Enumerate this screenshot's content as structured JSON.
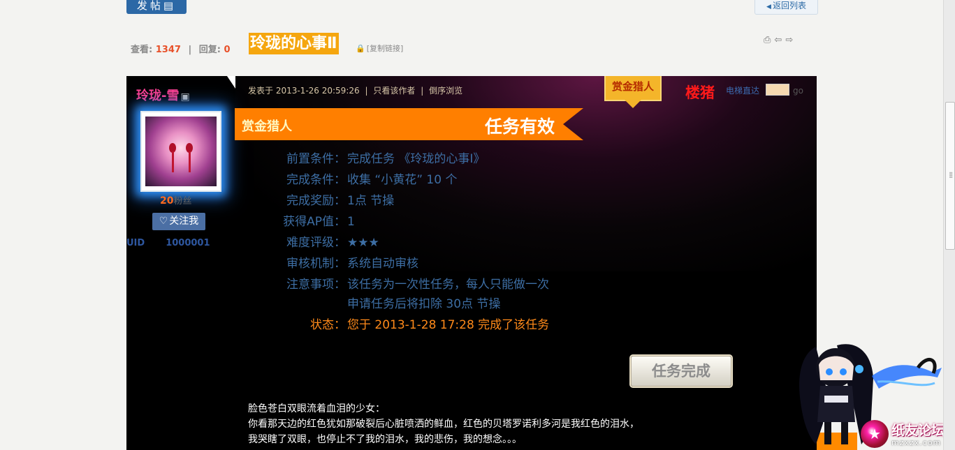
{
  "header": {
    "post_button": "发帖",
    "post_icon": "list-icon",
    "back_to_list": "返回列表"
  },
  "thread": {
    "views_label": "查看:",
    "views": "1347",
    "replies_label": "回复:",
    "replies": "0",
    "separator": "|",
    "title": "玲珑的心事Ⅱ",
    "copy_link": "[复制链接]",
    "tools": [
      "print-icon",
      "prev-icon",
      "next-icon"
    ]
  },
  "author": {
    "name": "玲珑-雪",
    "fans_count": "20",
    "fans_label": "粉丝",
    "follow_label": "关注我",
    "uid_label": "UID",
    "uid": "1000001"
  },
  "post_meta": {
    "posted": "发表于 2013-1-26 20:59:26",
    "sep": "|",
    "only_author": "只看该作者",
    "reverse": "倒序浏览",
    "hunter_badge": "赏金猎人",
    "floor": "楼猪",
    "elevator": "电梯直达",
    "go": "go"
  },
  "task": {
    "banner_left": "赏金猎人",
    "banner_right": "任务有效",
    "rows": [
      {
        "k": "前置条件：",
        "v": "完成任务 《玲珑的心事Ⅰ》"
      },
      {
        "k": "完成条件：",
        "v": "收集 “小黄花” 10 个"
      },
      {
        "k": "完成奖励：",
        "v": "1点 节操"
      },
      {
        "k": "获得AP值：",
        "v": "1"
      },
      {
        "k": "难度评级：",
        "v": "★★★"
      },
      {
        "k": "审核机制：",
        "v": "系统自动审核"
      },
      {
        "k": "注意事项：",
        "v": "该任务为一次性任务，每人只能做一次"
      },
      {
        "k": "",
        "v": "申请任务后将扣除 30点 节操"
      },
      {
        "k": "状态：",
        "v": "您于 2013-1-28 17:28 完成了该任务"
      }
    ],
    "done_button": "任务完成"
  },
  "body": [
    "脸色苍白双眼流着血泪的少女：",
    "你看那天边的红色犹如那破裂后心脏喷洒的鲜血，红色的贝塔罗诺利多河是我红色的泪水，",
    "我哭瞎了双眼，也停止不了我的泪水，我的悲伤，我的想念。。。"
  ],
  "watermark": {
    "site_name": "纸友论坛",
    "domain": "mzxzx.com"
  },
  "colors": {
    "accent_orange": "#ff7f00",
    "title_bg": "#f5a60f",
    "link_blue": "#3d6ea4",
    "status_orange": "#ff8a1a",
    "username_pink": "#ff3e8f",
    "floor_red": "#ff1a1a"
  }
}
